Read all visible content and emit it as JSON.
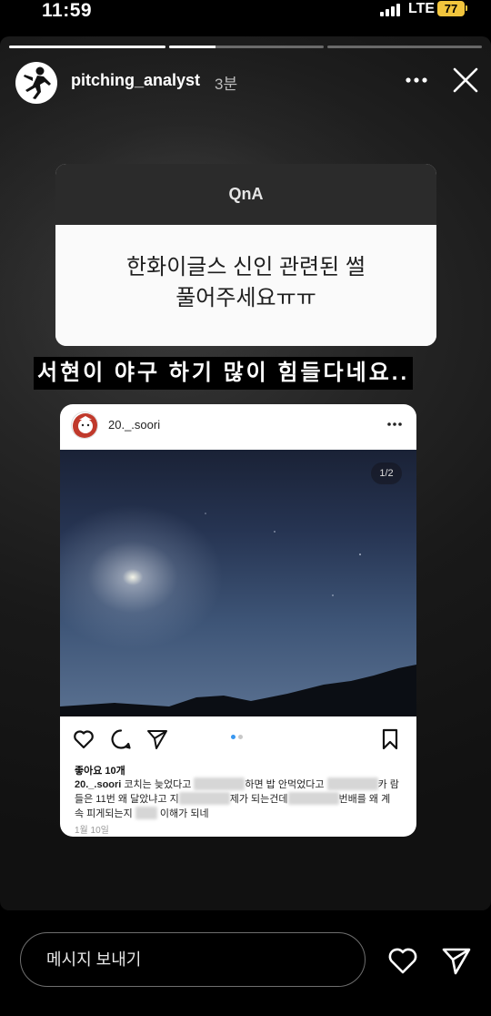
{
  "status_bar": {
    "time": "11:59",
    "network": "LTE",
    "battery": "77",
    "battery_color": "#f2c53d"
  },
  "story": {
    "progress_segments": [
      1.0,
      0.3,
      0.0
    ],
    "username": "pitching_analyst",
    "timestamp": "3분",
    "more_icon": "more-horizontal-icon",
    "close_icon": "close-icon"
  },
  "qna": {
    "title": "QnA",
    "question_line1": "한화이글스 신인 관련된 썰",
    "question_line2": "풀어주세요ㅠㅠ"
  },
  "caption": "서현이 야구 하기 많이 힘들다네요..",
  "post": {
    "username": "20._.soori",
    "page_indicator": "1/2",
    "carousel_active_index": 0,
    "likes": "좋아요 10개",
    "caption_user": "20._.soori",
    "caption_parts": [
      "코치는 늦었다고",
      "하면 밥 안먹었다고",
      "카",
      "람들은 11번 왜 달았냐고 지",
      "제가 되는건데",
      "번배를 왜 계",
      "속 피게되는지",
      "이해가 되네"
    ],
    "date": "1월 10일",
    "accent_color": "#3897f0"
  },
  "reply_bar": {
    "placeholder": "메시지 보내기"
  }
}
